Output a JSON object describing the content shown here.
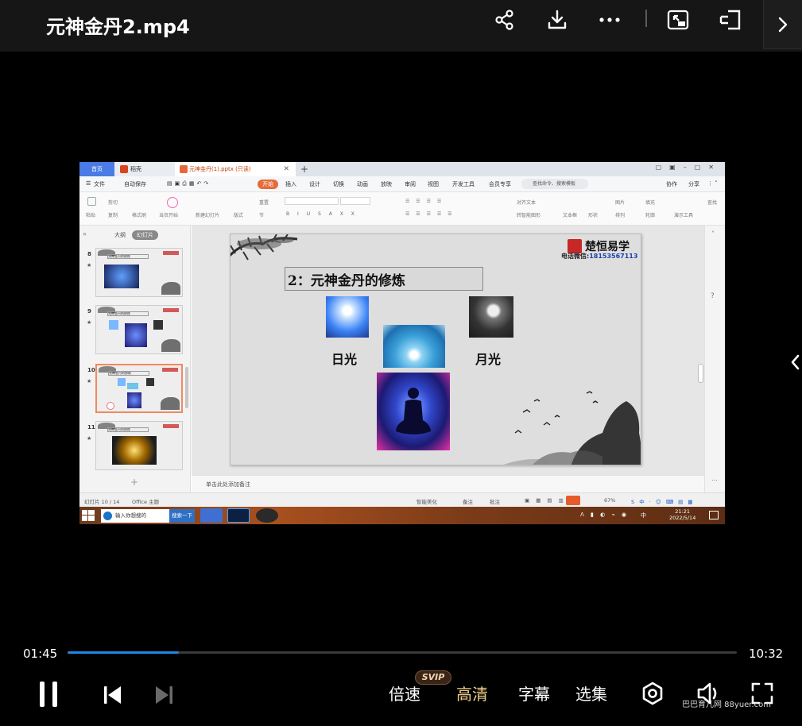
{
  "header": {
    "title": "元神金丹2.mp4",
    "icons": [
      "share-icon",
      "download-icon",
      "more-icon",
      "pip-icon",
      "cast-icon",
      "chevron-right-icon"
    ]
  },
  "video_frame": {
    "tabs": {
      "home": "首页",
      "shell": "稻壳",
      "doc": "元神金丹(1).pptx (只读)"
    },
    "menu": {
      "file": "文件",
      "autosave": "自动保存",
      "items": [
        "开始",
        "插入",
        "设计",
        "切换",
        "动画",
        "放映",
        "审阅",
        "视图",
        "开发工具",
        "会员专享"
      ],
      "search": "查找命令、搜索模板",
      "collab": "协作",
      "share": "分享"
    },
    "ribbon": {
      "paste": "粘贴",
      "cut": "剪切",
      "copy": "复制",
      "format_painter": "格式刷",
      "play_from_current": "当页开始",
      "new_slide": "新建幻灯片",
      "layout": "版式",
      "reset": "重置",
      "section": "节",
      "textbox": "文本框",
      "shape": "形状",
      "arrange": "排列",
      "outline": "轮廓",
      "present_tools": "演示工具",
      "align_text": "对齐文本",
      "smart_shape": "转智能图形",
      "image": "图片",
      "fill": "填充",
      "find": "查找"
    },
    "left_panel": {
      "tab_outline": "大纲",
      "tab_slides": "幻灯片",
      "thumb_title": "元神金丹的修炼",
      "slides": [
        {
          "num": "8",
          "star": "★"
        },
        {
          "num": "9",
          "star": "★"
        },
        {
          "num": "10",
          "star": "★"
        },
        {
          "num": "11",
          "star": "★"
        }
      ],
      "add": "+"
    },
    "slide": {
      "title": "2：元神金丹的修炼",
      "brand": "楚恒易学",
      "phone_label": "电话微信:",
      "phone": "18153567113",
      "label_sun": "日光",
      "label_moon": "月光"
    },
    "notes_placeholder": "单击此处添加备注",
    "status": {
      "slide_counter": "幻灯片 10 / 14",
      "theme": "Office 主题",
      "beautify": "智能美化",
      "notes": "备注",
      "comments": "批注",
      "zoom": "67%"
    },
    "taskbar": {
      "search_placeholder": "输入你想搜的",
      "search_btn": "搜索一下",
      "time": "21:21",
      "date": "2022/5/14",
      "ime": "中"
    }
  },
  "player": {
    "current_time": "01:45",
    "total_time": "10:32",
    "progress": 0.166,
    "speed": "倍速",
    "svip_badge": "SVIP",
    "quality": "高清",
    "subtitles": "字幕",
    "episodes": "选集",
    "watermark": "巴巴育儿网 88yuer.com",
    "colors": {
      "progress": "#1e88e5",
      "quality": "#f1cf8c",
      "accent": "#e46c3a"
    }
  }
}
